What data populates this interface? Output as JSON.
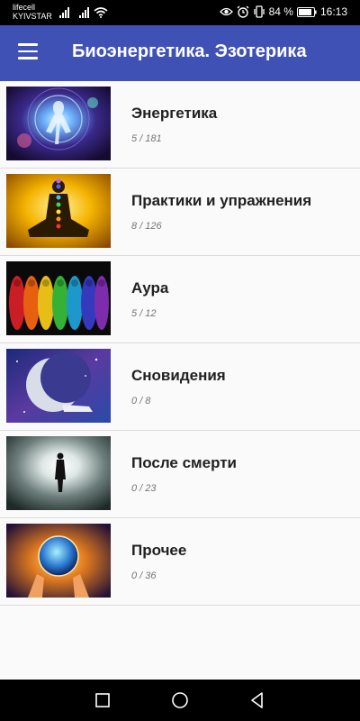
{
  "status_bar": {
    "carrier_1": "lifecell",
    "carrier_2": "KYIVSTAR",
    "battery_text": "84 %",
    "time": "16:13",
    "icons": [
      "signal-icon",
      "signal-icon",
      "wifi-icon",
      "eye-icon",
      "alarm-icon",
      "vibrate-icon",
      "battery-icon"
    ]
  },
  "app_bar": {
    "title": "Биоэнергетика. Эзотерика",
    "menu_icon": "hamburger-menu-icon",
    "color": "#3f51b5"
  },
  "categories": [
    {
      "title": "Энергетика",
      "count": "5 / 181",
      "image": "energy-aura-figure-image"
    },
    {
      "title": "Практики и упражнения",
      "count": "8 / 126",
      "image": "meditation-chakras-image"
    },
    {
      "title": "Аура",
      "count": "5 / 12",
      "image": "rainbow-aura-figures-image"
    },
    {
      "title": "Сновидения",
      "count": "0 / 8",
      "image": "crescent-moon-sleeper-image"
    },
    {
      "title": "После смерти",
      "count": "0 / 23",
      "image": "light-tunnel-figure-image"
    },
    {
      "title": "Прочее",
      "count": "0 / 36",
      "image": "hands-holding-sphere-image"
    }
  ],
  "nav_bar": {
    "buttons": [
      "recents-square-icon",
      "home-circle-icon",
      "back-triangle-icon"
    ]
  }
}
